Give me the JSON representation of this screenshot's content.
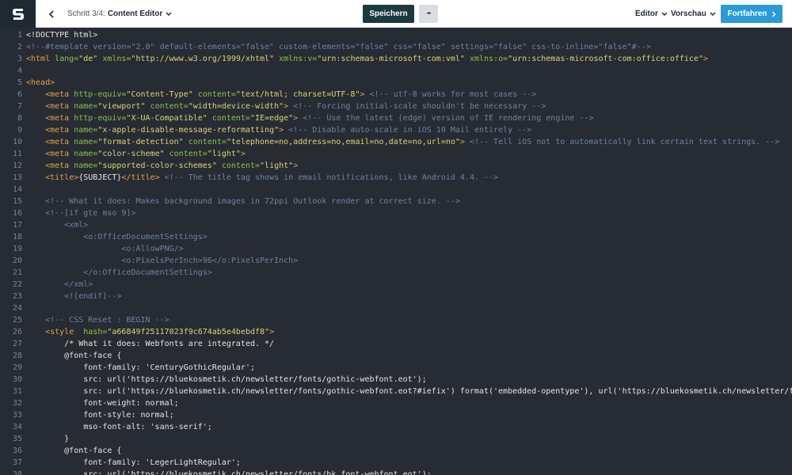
{
  "header": {
    "step_label": "Schritt 3/4:",
    "step_value": "Content Editor",
    "save_label": "Speichern",
    "more_label": "•••",
    "editor_label": "Editor",
    "preview_label": "Vorschau",
    "continue_label": "Fortfahren"
  },
  "icons": {
    "logo": "app-logo",
    "back": "chevron-left-icon",
    "step_dropdown": "chevron-down-icon",
    "editor_dropdown": "chevron-down-icon",
    "preview_dropdown": "chevron-down-icon",
    "continue": "chevron-right-icon"
  },
  "colors": {
    "accent": "#2a9bd4",
    "save_button": "#1b3a40",
    "editor_background": "#272b33",
    "tag": "#e4a246",
    "attribute": "#86c44d",
    "string": "#dcd579",
    "comment": "#6e83a3"
  },
  "code_lines": [
    {
      "n": "1",
      "tokens": [
        {
          "t": "<!DOCTYPE html>",
          "c": "text"
        }
      ]
    },
    {
      "n": "2",
      "tokens": [
        {
          "t": "<!--#template version=\"2.0\" default-elements=\"false\" custom-elements=\"false\" css=\"false\" settings=\"false\" css-to-inline=\"false\"#-->",
          "c": "cmt"
        }
      ]
    },
    {
      "n": "3",
      "tokens": [
        {
          "t": "<html ",
          "c": "tag"
        },
        {
          "t": "lang=",
          "c": "attr"
        },
        {
          "t": "\"de\"",
          "c": "str"
        },
        {
          "t": " xmlns=",
          "c": "attr"
        },
        {
          "t": "\"http://www.w3.org/1999/xhtml\"",
          "c": "str"
        },
        {
          "t": " xmlns:v=",
          "c": "attr"
        },
        {
          "t": "\"urn:schemas-microsoft-com:vml\"",
          "c": "str"
        },
        {
          "t": " xmlns:o=",
          "c": "attr"
        },
        {
          "t": "\"urn:schemas-microsoft-com:office:office\"",
          "c": "str"
        },
        {
          "t": ">",
          "c": "tag"
        }
      ]
    },
    {
      "n": "4",
      "tokens": []
    },
    {
      "n": "5",
      "tokens": [
        {
          "t": "<head>",
          "c": "tag"
        }
      ]
    },
    {
      "n": "6",
      "tokens": [
        {
          "t": "    ",
          "c": "text"
        },
        {
          "t": "<meta ",
          "c": "tag"
        },
        {
          "t": "http-equiv=",
          "c": "attr"
        },
        {
          "t": "\"Content-Type\"",
          "c": "str"
        },
        {
          "t": " content=",
          "c": "attr"
        },
        {
          "t": "\"text/html; charset=UTF-8\"",
          "c": "str"
        },
        {
          "t": ">",
          "c": "tag"
        },
        {
          "t": " <!-- utf-8 works for most cases -->",
          "c": "cmt"
        }
      ]
    },
    {
      "n": "7",
      "tokens": [
        {
          "t": "    ",
          "c": "text"
        },
        {
          "t": "<meta ",
          "c": "tag"
        },
        {
          "t": "name=",
          "c": "attr"
        },
        {
          "t": "\"viewport\"",
          "c": "str"
        },
        {
          "t": " content=",
          "c": "attr"
        },
        {
          "t": "\"width=device-width\"",
          "c": "str"
        },
        {
          "t": ">",
          "c": "tag"
        },
        {
          "t": " <!-- Forcing initial-scale shouldn't be necessary -->",
          "c": "cmt"
        }
      ]
    },
    {
      "n": "8",
      "tokens": [
        {
          "t": "    ",
          "c": "text"
        },
        {
          "t": "<meta ",
          "c": "tag"
        },
        {
          "t": "http-equiv=",
          "c": "attr"
        },
        {
          "t": "\"X-UA-Compatible\"",
          "c": "str"
        },
        {
          "t": " content=",
          "c": "attr"
        },
        {
          "t": "\"IE=edge\"",
          "c": "str"
        },
        {
          "t": ">",
          "c": "tag"
        },
        {
          "t": " <!-- Use the latest (edge) version of IE rendering engine -->",
          "c": "cmt"
        }
      ]
    },
    {
      "n": "9",
      "tokens": [
        {
          "t": "    ",
          "c": "text"
        },
        {
          "t": "<meta ",
          "c": "tag"
        },
        {
          "t": "name=",
          "c": "attr"
        },
        {
          "t": "\"x-apple-disable-message-reformatting\"",
          "c": "str"
        },
        {
          "t": ">",
          "c": "tag"
        },
        {
          "t": " <!-- Disable auto-scale in iOS 10 Mail entirely -->",
          "c": "cmt"
        }
      ]
    },
    {
      "n": "10",
      "tokens": [
        {
          "t": "    ",
          "c": "text"
        },
        {
          "t": "<meta ",
          "c": "tag"
        },
        {
          "t": "name=",
          "c": "attr"
        },
        {
          "t": "\"format-detection\"",
          "c": "str"
        },
        {
          "t": " content=",
          "c": "attr"
        },
        {
          "t": "\"telephone=no,address=no,email=no,date=no,url=no\"",
          "c": "str"
        },
        {
          "t": ">",
          "c": "tag"
        },
        {
          "t": " <!-- Tell iOS not to automatically link certain text strings. -->",
          "c": "cmt"
        }
      ]
    },
    {
      "n": "11",
      "tokens": [
        {
          "t": "    ",
          "c": "text"
        },
        {
          "t": "<meta ",
          "c": "tag"
        },
        {
          "t": "name=",
          "c": "attr"
        },
        {
          "t": "\"color-scheme\"",
          "c": "str"
        },
        {
          "t": " content=",
          "c": "attr"
        },
        {
          "t": "\"light\"",
          "c": "str"
        },
        {
          "t": ">",
          "c": "tag"
        }
      ]
    },
    {
      "n": "12",
      "tokens": [
        {
          "t": "    ",
          "c": "text"
        },
        {
          "t": "<meta ",
          "c": "tag"
        },
        {
          "t": "name=",
          "c": "attr"
        },
        {
          "t": "\"supported-color-schemes\"",
          "c": "str"
        },
        {
          "t": " content=",
          "c": "attr"
        },
        {
          "t": "\"light\"",
          "c": "str"
        },
        {
          "t": ">",
          "c": "tag"
        }
      ]
    },
    {
      "n": "13",
      "tokens": [
        {
          "t": "    ",
          "c": "text"
        },
        {
          "t": "<title>",
          "c": "tag"
        },
        {
          "t": "{SUBJECT}",
          "c": "text"
        },
        {
          "t": "</title>",
          "c": "tag"
        },
        {
          "t": " <!-- The title tag shows in email notifications, like Android 4.4. -->",
          "c": "cmt"
        }
      ]
    },
    {
      "n": "14",
      "tokens": []
    },
    {
      "n": "15",
      "tokens": [
        {
          "t": "    <!-- What it does: Makes background images in 72ppi Outlook render at correct size. -->",
          "c": "cmt"
        }
      ]
    },
    {
      "n": "16",
      "tokens": [
        {
          "t": "    <!--[if gte mso 9]>",
          "c": "cmt"
        }
      ]
    },
    {
      "n": "17",
      "tokens": [
        {
          "t": "        <xml>",
          "c": "cmt"
        }
      ]
    },
    {
      "n": "18",
      "tokens": [
        {
          "t": "            <o:OfficeDocumentSettings>",
          "c": "cmt"
        }
      ]
    },
    {
      "n": "19",
      "tokens": [
        {
          "t": "                    <o:AllowPNG/>",
          "c": "cmt"
        }
      ]
    },
    {
      "n": "20",
      "tokens": [
        {
          "t": "                    <o:PixelsPerInch>96</o:PixelsPerInch>",
          "c": "cmt"
        }
      ]
    },
    {
      "n": "21",
      "tokens": [
        {
          "t": "            </o:OfficeDocumentSettings>",
          "c": "cmt"
        }
      ]
    },
    {
      "n": "22",
      "tokens": [
        {
          "t": "        </xml>",
          "c": "cmt"
        }
      ]
    },
    {
      "n": "23",
      "tokens": [
        {
          "t": "        <![endif]-->",
          "c": "cmt"
        }
      ]
    },
    {
      "n": "24",
      "tokens": []
    },
    {
      "n": "25",
      "tokens": [
        {
          "t": "    <!-- CSS Reset : BEGIN -->",
          "c": "cmt"
        }
      ]
    },
    {
      "n": "26",
      "tokens": [
        {
          "t": "    ",
          "c": "text"
        },
        {
          "t": "<style  ",
          "c": "tag"
        },
        {
          "t": "hash=",
          "c": "attr"
        },
        {
          "t": "\"a66849f25117023f9c674ab5e4bebdf8\"",
          "c": "str"
        },
        {
          "t": ">",
          "c": "tag"
        }
      ]
    },
    {
      "n": "27",
      "tokens": [
        {
          "t": "        /* What it does: Webfonts are integrated. */",
          "c": "text"
        }
      ]
    },
    {
      "n": "28",
      "tokens": [
        {
          "t": "        @font-face {",
          "c": "text"
        }
      ]
    },
    {
      "n": "29",
      "tokens": [
        {
          "t": "            font-family: 'CenturyGothicRegular';",
          "c": "text"
        }
      ]
    },
    {
      "n": "30",
      "tokens": [
        {
          "t": "            src: url('https://bluekosmetik.ch/newsletter/fonts/gothic-webfont.eot');",
          "c": "text"
        }
      ]
    },
    {
      "n": "31",
      "tokens": [
        {
          "t": "            src: url('https://bluekosmetik.ch/newsletter/fonts/gothic-webfont.eot?#iefix') format('embedded-opentype'), url('https://bluekosmetik.ch/newsletter/f",
          "c": "text"
        }
      ]
    },
    {
      "n": "32",
      "tokens": [
        {
          "t": "            font-weight: normal;",
          "c": "text"
        }
      ]
    },
    {
      "n": "33",
      "tokens": [
        {
          "t": "            font-style: normal;",
          "c": "text"
        }
      ]
    },
    {
      "n": "34",
      "tokens": [
        {
          "t": "            mso-font-alt: 'sans-serif';",
          "c": "text"
        }
      ]
    },
    {
      "n": "35",
      "tokens": [
        {
          "t": "        }",
          "c": "text"
        }
      ]
    },
    {
      "n": "36",
      "tokens": [
        {
          "t": "        @font-face {",
          "c": "text"
        }
      ]
    },
    {
      "n": "37",
      "tokens": [
        {
          "t": "            font-family: 'LegerLightRegular';",
          "c": "text"
        }
      ]
    },
    {
      "n": "38",
      "tokens": [
        {
          "t": "            src: url('https://bluekosmetik.ch/newsletter/fonts/bk_font-webfont.eot');",
          "c": "text"
        }
      ]
    }
  ]
}
